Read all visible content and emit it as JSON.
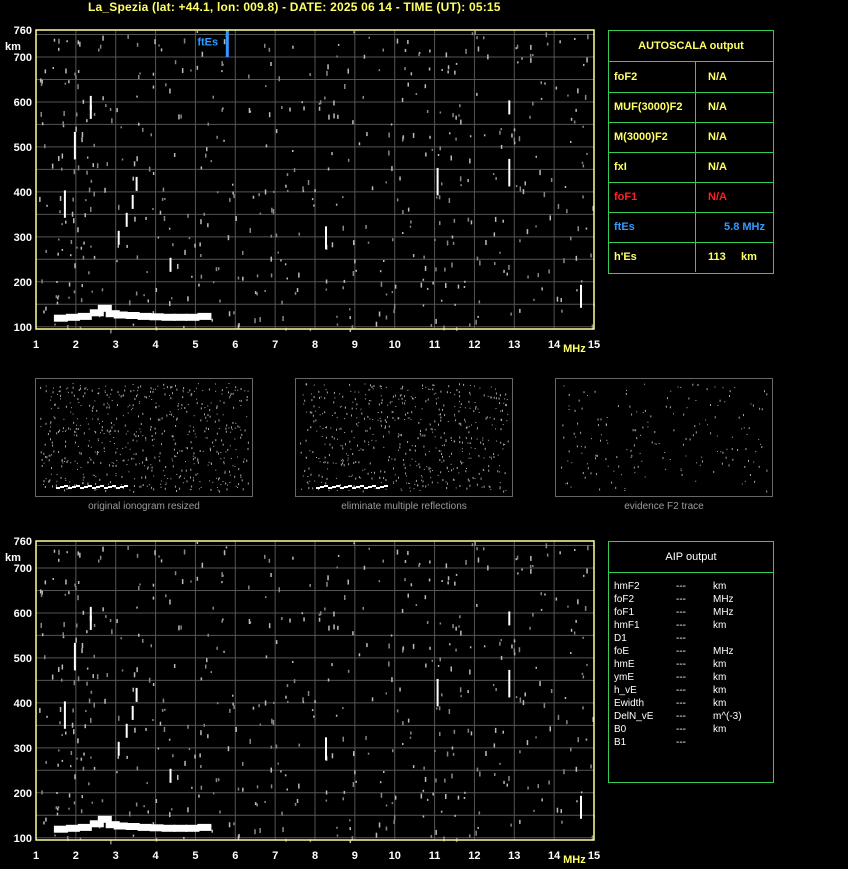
{
  "header": {
    "title": "La_Spezia (lat: +44.1, lon: 009.8) - DATE: 2025 06 14 - TIME (UT): 05:15"
  },
  "autoscala": {
    "title": "AUTOSCALA output",
    "rows": [
      {
        "label": "foF2",
        "value": "N/A",
        "color": "#ffff66"
      },
      {
        "label": "MUF(3000)F2",
        "value": "N/A",
        "color": "#ffff66"
      },
      {
        "label": "M(3000)F2",
        "value": "N/A",
        "color": "#ffff66"
      },
      {
        "label": "fxI",
        "value": "N/A",
        "color": "#ffff66"
      },
      {
        "label": "foF1",
        "value": "N/A",
        "color": "#ff2020"
      },
      {
        "label": "ftEs",
        "value": "5.8 MHz",
        "color": "#3399ff"
      },
      {
        "label": "h'Es",
        "value": "113",
        "unit": "km",
        "color": "#ffff66"
      }
    ]
  },
  "aip": {
    "title": "AIP output",
    "rows": [
      {
        "name": "hmF2",
        "dash": "---",
        "unit": "km"
      },
      {
        "name": "foF2",
        "dash": "---",
        "unit": "MHz"
      },
      {
        "name": "foF1",
        "dash": "---",
        "unit": "MHz"
      },
      {
        "name": "hmF1",
        "dash": "---",
        "unit": "km"
      },
      {
        "name": "D1",
        "dash": "---",
        "unit": ""
      },
      {
        "name": "foE",
        "dash": "---",
        "unit": "MHz"
      },
      {
        "name": "hmE",
        "dash": "---",
        "unit": "km"
      },
      {
        "name": "ymE",
        "dash": "---",
        "unit": "km"
      },
      {
        "name": "h_vE",
        "dash": "---",
        "unit": "km"
      },
      {
        "name": "Ewidth",
        "dash": "---",
        "unit": "km"
      },
      {
        "name": "DelN_vE",
        "dash": "---",
        "unit": "m^(-3)"
      },
      {
        "name": "B0",
        "dash": "---",
        "unit": "km"
      },
      {
        "name": "B1",
        "dash": "---",
        "unit": ""
      }
    ]
  },
  "thumbnails": [
    {
      "caption": "original ionogram resized"
    },
    {
      "caption": "eliminate multiple reflections"
    },
    {
      "caption": "evidence F2 trace"
    }
  ],
  "colors": {
    "axis": "#ffff99",
    "grid": "#555555",
    "panel_border": "#33cc55",
    "header": "#ffff66",
    "ftes_marker": "#3399ff",
    "trace": "#ffffff",
    "noise": "#bbbbbb"
  },
  "chart_data": [
    {
      "type": "scatter",
      "title": "",
      "xlabel": "MHz",
      "ylabel": "km",
      "xlim": [
        1,
        15
      ],
      "ylim": [
        95,
        760
      ],
      "x_ticks": [
        1,
        2,
        3,
        4,
        5,
        6,
        7,
        8,
        9,
        10,
        11,
        12,
        13,
        14,
        15
      ],
      "y_ticks": [
        100,
        200,
        300,
        400,
        500,
        600,
        700,
        760
      ],
      "grid": true,
      "ftEs_marker": {
        "label": "ftEs",
        "x": 5.8,
        "y_range": [
          700,
          760
        ]
      },
      "series": [
        {
          "values_desc": "Es trace",
          "points": [
            [
              1.5,
              118
            ],
            [
              1.8,
              120
            ],
            [
              2.1,
              122
            ],
            [
              2.4,
              130
            ],
            [
              2.6,
              140
            ],
            [
              2.8,
              128
            ],
            [
              3.0,
              125
            ],
            [
              3.3,
              124
            ],
            [
              3.6,
              122
            ],
            [
              3.9,
              121
            ],
            [
              4.2,
              120
            ],
            [
              4.5,
              120
            ],
            [
              4.8,
              120
            ],
            [
              5.1,
              122
            ]
          ]
        },
        {
          "values_desc": "trace segments",
          "points": [
            [
              1.75,
              360
            ],
            [
              1.75,
              390
            ],
            [
              2.0,
              490
            ],
            [
              2.0,
              520
            ],
            [
              2.4,
              580
            ],
            [
              2.4,
              600
            ],
            [
              3.1,
              300
            ],
            [
              3.3,
              340
            ],
            [
              3.45,
              380
            ],
            [
              3.55,
              420
            ],
            [
              4.4,
              240
            ],
            [
              8.3,
              290
            ],
            [
              8.3,
              310
            ],
            [
              11.1,
              410
            ],
            [
              11.1,
              440
            ],
            [
              12.9,
              430
            ],
            [
              12.9,
              460
            ],
            [
              12.9,
              590
            ],
            [
              14.7,
              160
            ],
            [
              14.7,
              180
            ]
          ]
        }
      ]
    },
    {
      "type": "scatter",
      "title": "",
      "xlabel": "MHz",
      "ylabel": "km",
      "xlim": [
        1,
        15
      ],
      "ylim": [
        95,
        760
      ],
      "x_ticks": [
        1,
        2,
        3,
        4,
        5,
        6,
        7,
        8,
        9,
        10,
        11,
        12,
        13,
        14,
        15
      ],
      "y_ticks": [
        100,
        200,
        300,
        400,
        500,
        600,
        700,
        760
      ],
      "grid": true,
      "series": [
        {
          "values_desc": "Es trace",
          "points": [
            [
              1.5,
              118
            ],
            [
              1.8,
              120
            ],
            [
              2.1,
              122
            ],
            [
              2.4,
              130
            ],
            [
              2.6,
              140
            ],
            [
              2.8,
              128
            ],
            [
              3.0,
              125
            ],
            [
              3.3,
              124
            ],
            [
              3.6,
              122
            ],
            [
              3.9,
              121
            ],
            [
              4.2,
              120
            ],
            [
              4.5,
              120
            ],
            [
              4.8,
              120
            ],
            [
              5.1,
              122
            ]
          ]
        },
        {
          "values_desc": "trace segments",
          "points": [
            [
              1.75,
              360
            ],
            [
              1.75,
              390
            ],
            [
              2.0,
              490
            ],
            [
              2.0,
              520
            ],
            [
              2.4,
              580
            ],
            [
              2.4,
              600
            ],
            [
              3.1,
              300
            ],
            [
              3.3,
              340
            ],
            [
              3.45,
              380
            ],
            [
              3.55,
              420
            ],
            [
              4.4,
              240
            ],
            [
              8.3,
              290
            ],
            [
              8.3,
              310
            ],
            [
              11.1,
              410
            ],
            [
              11.1,
              440
            ],
            [
              12.9,
              430
            ],
            [
              12.9,
              460
            ],
            [
              12.9,
              590
            ],
            [
              14.7,
              160
            ],
            [
              14.7,
              180
            ]
          ]
        }
      ]
    }
  ]
}
